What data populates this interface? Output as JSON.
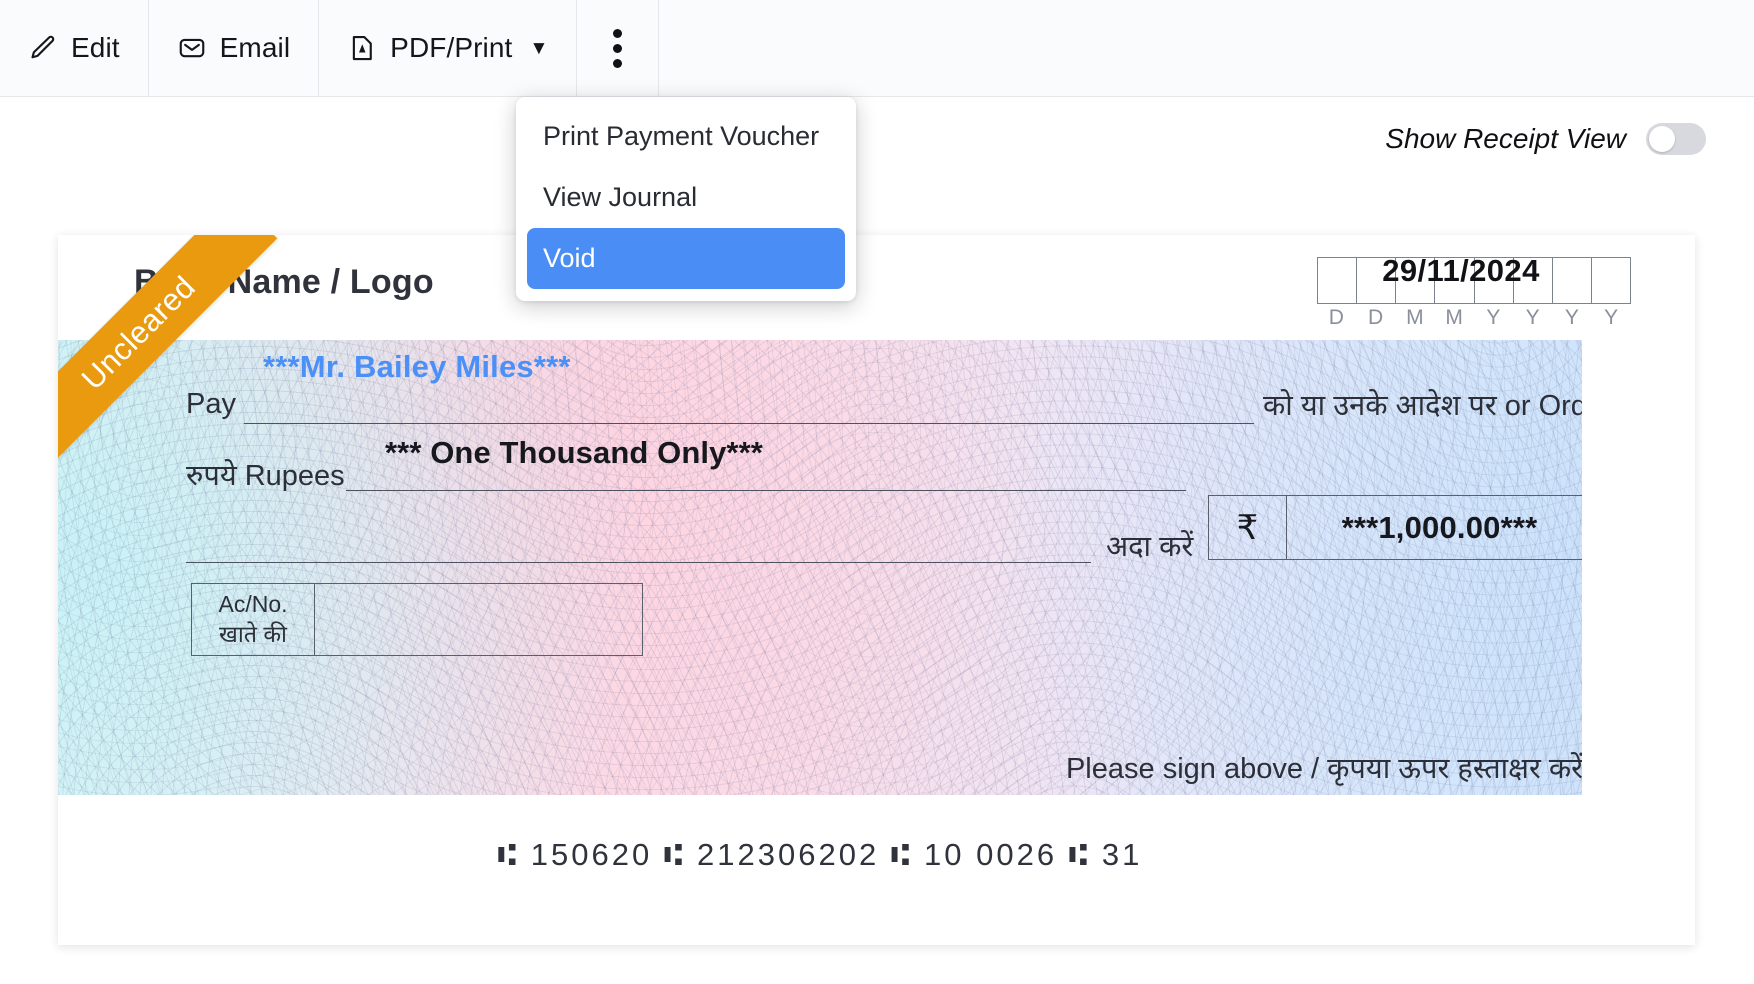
{
  "toolbar": {
    "buttons": [
      {
        "label": "Edit",
        "icon": "pencil-icon"
      },
      {
        "label": "Email",
        "icon": "envelope-icon"
      },
      {
        "label": "PDF/Print",
        "icon": "pdf-file-icon",
        "caret": "▼"
      }
    ],
    "more_icon": "three-dots-vertical-icon"
  },
  "menu": {
    "items": [
      {
        "label": "Print Payment Voucher",
        "selected": false
      },
      {
        "label": "View Journal",
        "selected": false
      },
      {
        "label": "Void",
        "selected": true
      }
    ],
    "highlight_color": "#4a8df5"
  },
  "receipt_toggle": {
    "label": "Show Receipt View",
    "state": "off"
  },
  "cheque": {
    "status_ribbon": {
      "text": "Uncleared",
      "color": "#e99a0f"
    },
    "bank_name": "Bank Name / Logo",
    "date": {
      "value": "29/11/2024",
      "cell_letters": [
        "D",
        "D",
        "M",
        "M",
        "Y",
        "Y",
        "Y",
        "Y"
      ]
    },
    "payee": {
      "label": "Pay",
      "name": "***Mr. Bailey Miles***",
      "name_color": "#4a90f7",
      "order_text": "को या उनके आदेश पर or Order"
    },
    "amount_words": {
      "label": "रुपये Rupees",
      "value": "*** One Thousand Only***",
      "pay_text": "अदा करें"
    },
    "amount_figures": {
      "currency_symbol": "₹",
      "value": "***1,000.00***"
    },
    "account_box": {
      "line1": "Ac/No.",
      "line2": "खाते की",
      "value": ""
    },
    "signature_text": "Please sign above / कृपया ऊपर हस्ताक्षर करें",
    "micr_line": "⑆ 150620 ⑆ 212306202 ⑆ 10 0026 ⑆ 31"
  }
}
